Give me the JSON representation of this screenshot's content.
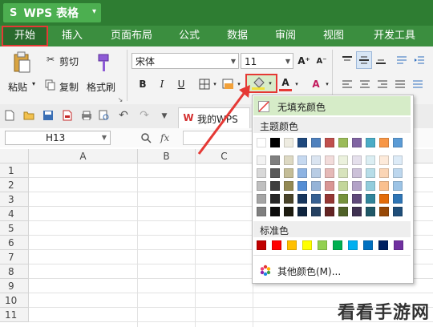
{
  "app": {
    "logo_glyph": "S",
    "title": "WPS 表格",
    "dropdown_glyph": "▾"
  },
  "menu": {
    "tabs": [
      "开始",
      "插入",
      "页面布局",
      "公式",
      "数据",
      "审阅",
      "视图",
      "开发工具"
    ]
  },
  "ribbon": {
    "paste_label": "粘贴",
    "cut_label": "剪切",
    "copy_label": "复制",
    "format_painter_label": "格式刷",
    "font_name": "宋体",
    "font_size": "11",
    "bold": "B",
    "italic": "I",
    "underline": "U",
    "font_color_glyph": "A",
    "grow_font": "A⁺",
    "shrink_font": "A⁻"
  },
  "quickbar": {
    "file_tab_label": "我的WPS"
  },
  "formula_bar": {
    "name_box": "H13",
    "fx": "fx"
  },
  "grid": {
    "columns": [
      "A",
      "B",
      "C"
    ],
    "rows": [
      "1",
      "2",
      "3",
      "4",
      "5",
      "6",
      "7",
      "8",
      "9",
      "10",
      "11"
    ]
  },
  "fill_popup": {
    "no_fill": "无填充颜色",
    "theme_colors_label": "主题颜色",
    "standard_colors_label": "标准色",
    "more_colors": "其他颜色(M)...",
    "theme_top": [
      "#ffffff",
      "#000000",
      "#eeece1",
      "#1f497d",
      "#4f81bd",
      "#c0504d",
      "#9bbb59",
      "#8064a2",
      "#4bacc6",
      "#f79646",
      "#5b9bd5"
    ],
    "theme_shades": [
      [
        "#f2f2f2",
        "#7f7f7f",
        "#ddd9c3",
        "#c6d9f0",
        "#dbe5f1",
        "#f2dcdb",
        "#ebf1dd",
        "#e5e0ec",
        "#dbeef3",
        "#fdeada",
        "#ddebf7"
      ],
      [
        "#d8d8d8",
        "#595959",
        "#c4bd97",
        "#8db3e2",
        "#b8cce4",
        "#e5b9b7",
        "#d7e3bc",
        "#ccc1d9",
        "#b7dde8",
        "#fbd5b5",
        "#bdd7ee"
      ],
      [
        "#bfbfbf",
        "#3f3f3f",
        "#938953",
        "#548dd4",
        "#95b3d7",
        "#d99694",
        "#c3d69b",
        "#b2a2c7",
        "#92cddc",
        "#fac08f",
        "#9cc3e5"
      ],
      [
        "#a5a5a5",
        "#262626",
        "#494429",
        "#17365d",
        "#366092",
        "#953734",
        "#76923c",
        "#5f497a",
        "#31859b",
        "#e36c09",
        "#2e75b5"
      ],
      [
        "#7f7f7f",
        "#0c0c0c",
        "#1d1b10",
        "#0f243e",
        "#244061",
        "#632423",
        "#4f6128",
        "#3f3151",
        "#205867",
        "#974806",
        "#1f4e79"
      ]
    ],
    "standard": [
      "#c00000",
      "#ff0000",
      "#ffc000",
      "#ffff00",
      "#92d050",
      "#00b050",
      "#00b0f0",
      "#0070c0",
      "#002060",
      "#7030a0"
    ]
  },
  "watermark": {
    "text": "看看手游网"
  },
  "colors": {
    "titlebar": "#2e7d32",
    "menubar": "#3b8e3f",
    "highlight": "#e53935"
  }
}
